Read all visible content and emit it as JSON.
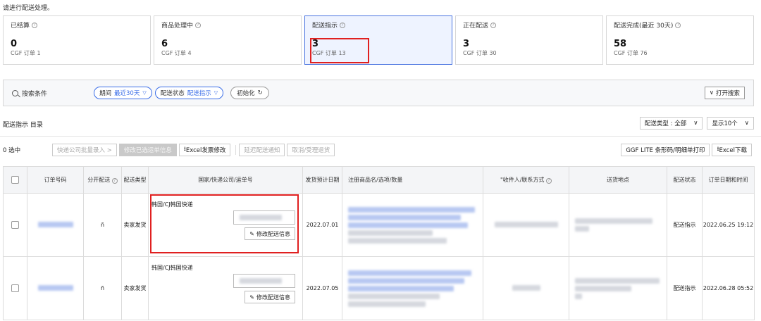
{
  "notice": "请进行配送处理。",
  "cards": [
    {
      "title": "已结算",
      "count": "0",
      "sub": "CGF 订单 1"
    },
    {
      "title": "商品处理中",
      "count": "6",
      "sub": "CGF 订单 4"
    },
    {
      "title": "配送指示",
      "count": "3",
      "sub": "CGF 订单 13",
      "active": true
    },
    {
      "title": "正在配送",
      "count": "3",
      "sub": "CGF 订单 30"
    },
    {
      "title": "配送完成(最近 30天)",
      "count": "58",
      "sub": "CGF 订单 76"
    }
  ],
  "search": {
    "label": "搜索条件",
    "filters": [
      {
        "name": "期间",
        "value": "最近30天"
      },
      {
        "name": "配送状态",
        "value": "配送指示"
      }
    ],
    "reset": "初始化",
    "open": "打开搜索"
  },
  "list": {
    "title": "配送指示 目录",
    "type_select": "配送类型 : 全部",
    "page_size_select": "显示10个"
  },
  "toolbar": {
    "selected": "0 选中",
    "buttons": [
      "快递公司批量录入 >",
      "修改已选运单信息",
      "Excel发票修改",
      "延迟配送通知",
      "取消/受理退货"
    ],
    "right_buttons": [
      "GGF LITE 条形码/明细单打印",
      "Excel下载"
    ]
  },
  "table": {
    "headers": [
      "订单号码",
      "分开配送",
      "配送类型",
      "国家/快递公司/运单号",
      "发货预计日期",
      "注册商品名/选项/数量",
      "\"收件人/联系方式",
      "送货地点",
      "配送状态",
      "订单日期和时间"
    ],
    "rows": [
      {
        "split": "ñ",
        "type": "卖家发货",
        "carrier": "韩国/CJ韩国快递",
        "modify": "修改配送信息",
        "ship_date": "2022.07.01",
        "status": "配送指示",
        "order_time": "2022.06.25 19:12"
      },
      {
        "split": "ñ",
        "type": "卖家发货",
        "carrier": "韩国/CJ韩国快递",
        "modify": "修改配送信息",
        "ship_date": "2022.07.05",
        "status": "配送指示",
        "order_time": "2022.06.28 05:52"
      }
    ]
  }
}
